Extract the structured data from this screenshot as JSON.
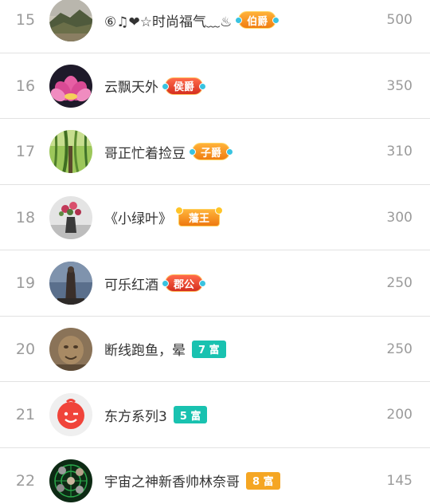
{
  "ranking": [
    {
      "rank": "15",
      "name": "⑥♫❤☆时尚福气﹏♨",
      "badge": "伯爵",
      "badge_type": "noble",
      "score": "500",
      "avatar_icon": "mountain-landscape-avatar"
    },
    {
      "rank": "16",
      "name": "云飘天外",
      "badge": "侯爵",
      "badge_type": "noble-red",
      "score": "350",
      "avatar_icon": "lotus-flower-avatar"
    },
    {
      "rank": "17",
      "name": "哥正忙着捡豆",
      "badge": "子爵",
      "badge_type": "noble",
      "score": "310",
      "avatar_icon": "green-willow-avatar"
    },
    {
      "rank": "18",
      "name": "《小绿叶》",
      "badge": "藩王",
      "badge_type": "king",
      "score": "300",
      "avatar_icon": "flower-vase-avatar"
    },
    {
      "rank": "19",
      "name": "可乐红酒",
      "badge": "郡公",
      "badge_type": "noble-red",
      "score": "250",
      "avatar_icon": "statue-avatar"
    },
    {
      "rank": "20",
      "name": "断线跑鱼，晕",
      "badge": "7 富",
      "badge_type": "rich",
      "badge_color": "#19c2b0",
      "score": "250",
      "avatar_icon": "carved-figure-avatar"
    },
    {
      "rank": "21",
      "name": "东方系列3",
      "badge": "5 富",
      "badge_type": "rich",
      "badge_color": "#19c2b0",
      "score": "200",
      "avatar_icon": "red-smiley-avatar"
    },
    {
      "rank": "22",
      "name": "宇宙之神新香帅林奈哥",
      "badge": "8 富",
      "badge_type": "rich",
      "badge_color": "#f5a623",
      "score": "145",
      "avatar_icon": "radar-group-avatar"
    }
  ]
}
